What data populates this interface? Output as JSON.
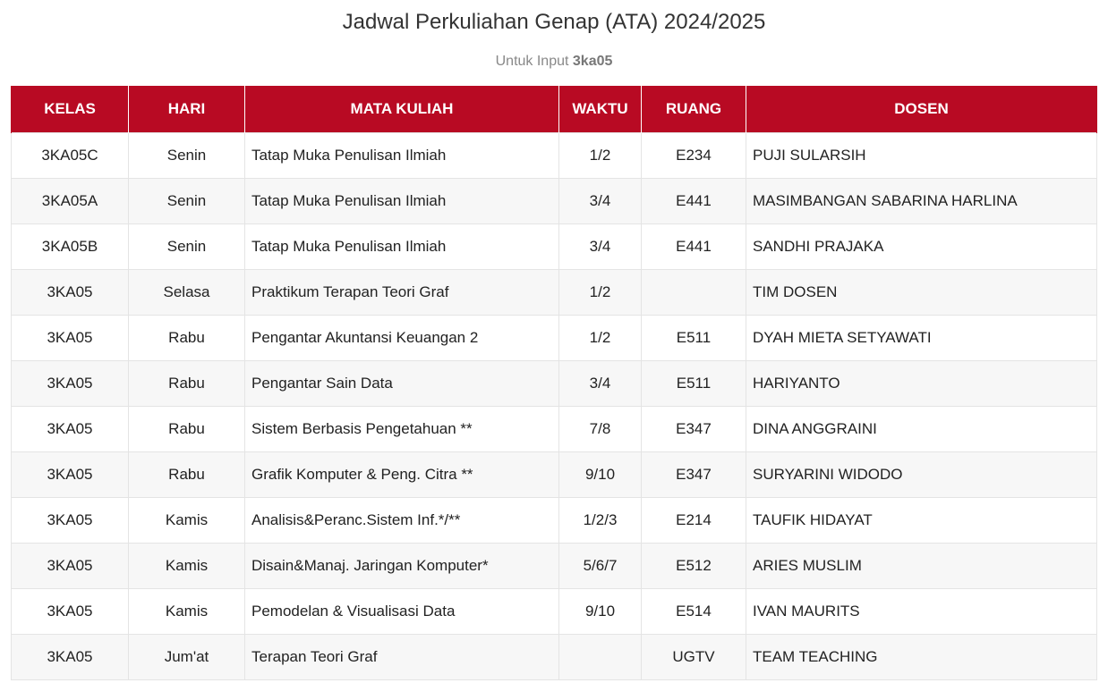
{
  "page": {
    "title": "Jadwal Perkuliahan Genap (ATA) 2024/2025",
    "subtitle_prefix": "Untuk Input",
    "subtitle_class": "3ka05"
  },
  "table": {
    "headers": {
      "kelas": "KELAS",
      "hari": "HARI",
      "mata_kuliah": "MATA KULIAH",
      "waktu": "WAKTU",
      "ruang": "RUANG",
      "dosen": "DOSEN"
    },
    "rows": [
      {
        "kelas": "3KA05C",
        "hari": "Senin",
        "mata_kuliah": "Tatap Muka Penulisan Ilmiah",
        "waktu": "1/2",
        "ruang": "E234",
        "dosen": "PUJI SULARSIH"
      },
      {
        "kelas": "3KA05A",
        "hari": "Senin",
        "mata_kuliah": "Tatap Muka Penulisan Ilmiah",
        "waktu": "3/4",
        "ruang": "E441",
        "dosen": "MASIMBANGAN SABARINA HARLINA"
      },
      {
        "kelas": "3KA05B",
        "hari": "Senin",
        "mata_kuliah": "Tatap Muka Penulisan Ilmiah",
        "waktu": "3/4",
        "ruang": "E441",
        "dosen": "SANDHI PRAJAKA"
      },
      {
        "kelas": "3KA05",
        "hari": "Selasa",
        "mata_kuliah": "Praktikum Terapan Teori Graf",
        "waktu": "1/2",
        "ruang": "",
        "dosen": "TIM DOSEN"
      },
      {
        "kelas": "3KA05",
        "hari": "Rabu",
        "mata_kuliah": "Pengantar Akuntansi Keuangan 2",
        "waktu": "1/2",
        "ruang": "E511",
        "dosen": "DYAH MIETA SETYAWATI"
      },
      {
        "kelas": "3KA05",
        "hari": "Rabu",
        "mata_kuliah": "Pengantar Sain Data",
        "waktu": "3/4",
        "ruang": "E511",
        "dosen": "HARIYANTO"
      },
      {
        "kelas": "3KA05",
        "hari": "Rabu",
        "mata_kuliah": "Sistem Berbasis Pengetahuan **",
        "waktu": "7/8",
        "ruang": "E347",
        "dosen": "DINA ANGGRAINI"
      },
      {
        "kelas": "3KA05",
        "hari": "Rabu",
        "mata_kuliah": "Grafik Komputer & Peng. Citra **",
        "waktu": "9/10",
        "ruang": "E347",
        "dosen": "SURYARINI WIDODO"
      },
      {
        "kelas": "3KA05",
        "hari": "Kamis",
        "mata_kuliah": "Analisis&Peranc.Sistem Inf.*/**",
        "waktu": "1/2/3",
        "ruang": "E214",
        "dosen": "TAUFIK HIDAYAT"
      },
      {
        "kelas": "3KA05",
        "hari": "Kamis",
        "mata_kuliah": "Disain&Manaj. Jaringan Komputer*",
        "waktu": "5/6/7",
        "ruang": "E512",
        "dosen": "ARIES MUSLIM"
      },
      {
        "kelas": "3KA05",
        "hari": "Kamis",
        "mata_kuliah": "Pemodelan & Visualisasi Data",
        "waktu": "9/10",
        "ruang": "E514",
        "dosen": "IVAN MAURITS"
      },
      {
        "kelas": "3KA05",
        "hari": "Jum'at",
        "mata_kuliah": "Terapan Teori Graf",
        "waktu": "",
        "ruang": "UGTV",
        "dosen": "TEAM TEACHING"
      }
    ]
  },
  "colors": {
    "header_bg": "#b80a23",
    "header_text": "#ffffff",
    "row_alt_bg": "#f7f7f7",
    "border": "#e4e4e4"
  }
}
